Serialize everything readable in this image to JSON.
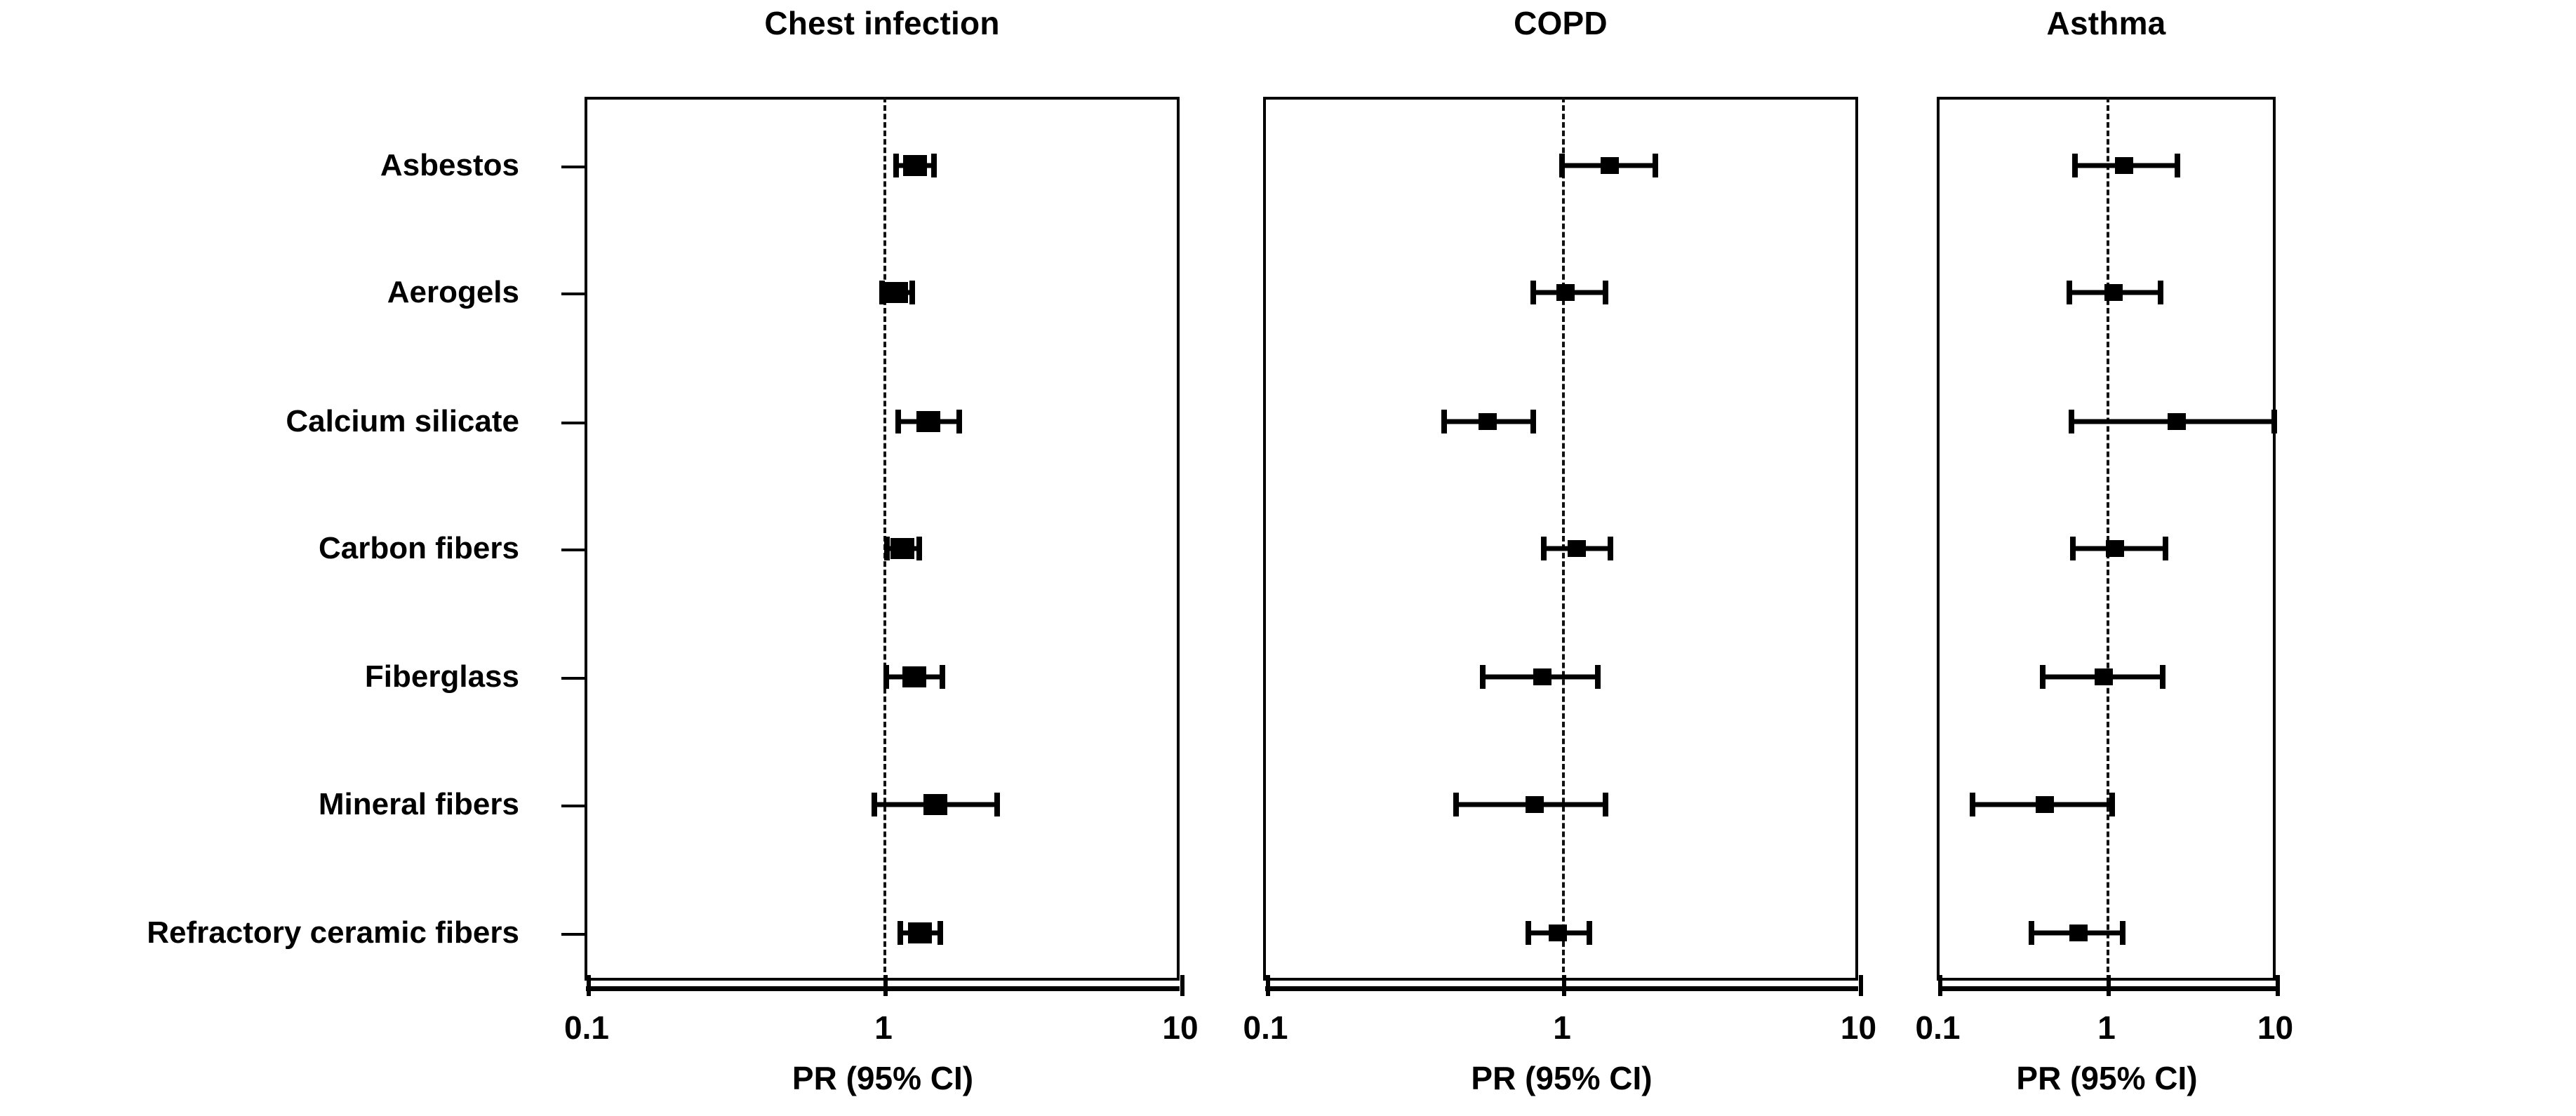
{
  "figure": {
    "type": "forest-plot",
    "row_labels": [
      "Asbestos",
      "Aerogels",
      "Calcium silicate",
      "Carbon fibers",
      "Fiberglass",
      "Mineral fibers",
      "Refractory ceramic fibers"
    ],
    "panels": [
      {
        "title": "Chest infection",
        "xlabel": "PR (95% CI)"
      },
      {
        "title": "COPD",
        "xlabel": "PR (95% CI)"
      },
      {
        "title": "Asthma",
        "xlabel": "PR (95% CI)"
      }
    ],
    "x_tick_labels": [
      "0.1",
      "1",
      "10"
    ]
  },
  "chart_data": {
    "type": "forest",
    "title": "",
    "xlabel": "PR (95% CI)",
    "ylabel": "",
    "xscale": "log",
    "xlim": [
      0.1,
      10
    ],
    "xticks": [
      0.1,
      1,
      10
    ],
    "xtick_labels": [
      "0.1",
      "1",
      "10"
    ],
    "reference_line": 1,
    "grid": false,
    "legend": "none",
    "categories": [
      "Asbestos",
      "Aerogels",
      "Calcium silicate",
      "Carbon fibers",
      "Fiberglass",
      "Mineral fibers",
      "Refractory ceramic fibers"
    ],
    "panels": [
      {
        "title": "Chest infection",
        "xlabel": "PR (95% CI)",
        "estimates": [
          {
            "category": "Asbestos",
            "pr": 1.28,
            "ci_low": 1.1,
            "ci_high": 1.48
          },
          {
            "category": "Aerogels",
            "pr": 1.1,
            "ci_low": 0.99,
            "ci_high": 1.25
          },
          {
            "category": "Calcium silicate",
            "pr": 1.42,
            "ci_low": 1.12,
            "ci_high": 1.8
          },
          {
            "category": "Carbon fibers",
            "pr": 1.16,
            "ci_low": 1.03,
            "ci_high": 1.32
          },
          {
            "category": "Fiberglass",
            "pr": 1.27,
            "ci_low": 1.02,
            "ci_high": 1.58
          },
          {
            "category": "Mineral fibers",
            "pr": 1.5,
            "ci_low": 0.93,
            "ci_high": 2.42
          },
          {
            "category": "Refractory ceramic fibers",
            "pr": 1.33,
            "ci_low": 1.14,
            "ci_high": 1.55
          }
        ]
      },
      {
        "title": "COPD",
        "xlabel": "PR (95% CI)",
        "estimates": [
          {
            "category": "Asbestos",
            "pr": 1.45,
            "ci_low": 1.0,
            "ci_high": 2.06
          },
          {
            "category": "Aerogels",
            "pr": 1.03,
            "ci_low": 0.8,
            "ci_high": 1.4
          },
          {
            "category": "Calcium silicate",
            "pr": 0.56,
            "ci_low": 0.4,
            "ci_high": 0.8
          },
          {
            "category": "Carbon fibers",
            "pr": 1.12,
            "ci_low": 0.87,
            "ci_high": 1.46
          },
          {
            "category": "Fiberglass",
            "pr": 0.86,
            "ci_low": 0.54,
            "ci_high": 1.32
          },
          {
            "category": "Mineral fibers",
            "pr": 0.81,
            "ci_low": 0.44,
            "ci_high": 1.4
          },
          {
            "category": "Refractory ceramic fibers",
            "pr": 0.97,
            "ci_low": 0.77,
            "ci_high": 1.24
          }
        ]
      },
      {
        "title": "Asthma",
        "xlabel": "PR (95% CI)",
        "estimates": [
          {
            "category": "Asbestos",
            "pr": 1.27,
            "ci_low": 0.65,
            "ci_high": 2.63
          },
          {
            "category": "Aerogels",
            "pr": 1.1,
            "ci_low": 0.6,
            "ci_high": 2.1
          },
          {
            "category": "Calcium silicate",
            "pr": 2.6,
            "ci_low": 0.62,
            "ci_high": 10.0
          },
          {
            "category": "Carbon fibers",
            "pr": 1.12,
            "ci_low": 0.63,
            "ci_high": 2.24
          },
          {
            "category": "Fiberglass",
            "pr": 0.96,
            "ci_low": 0.42,
            "ci_high": 2.16
          },
          {
            "category": "Mineral fibers",
            "pr": 0.43,
            "ci_low": 0.16,
            "ci_high": 1.08
          },
          {
            "category": "Refractory ceramic fibers",
            "pr": 0.68,
            "ci_low": 0.36,
            "ci_high": 1.25
          }
        ]
      }
    ]
  }
}
